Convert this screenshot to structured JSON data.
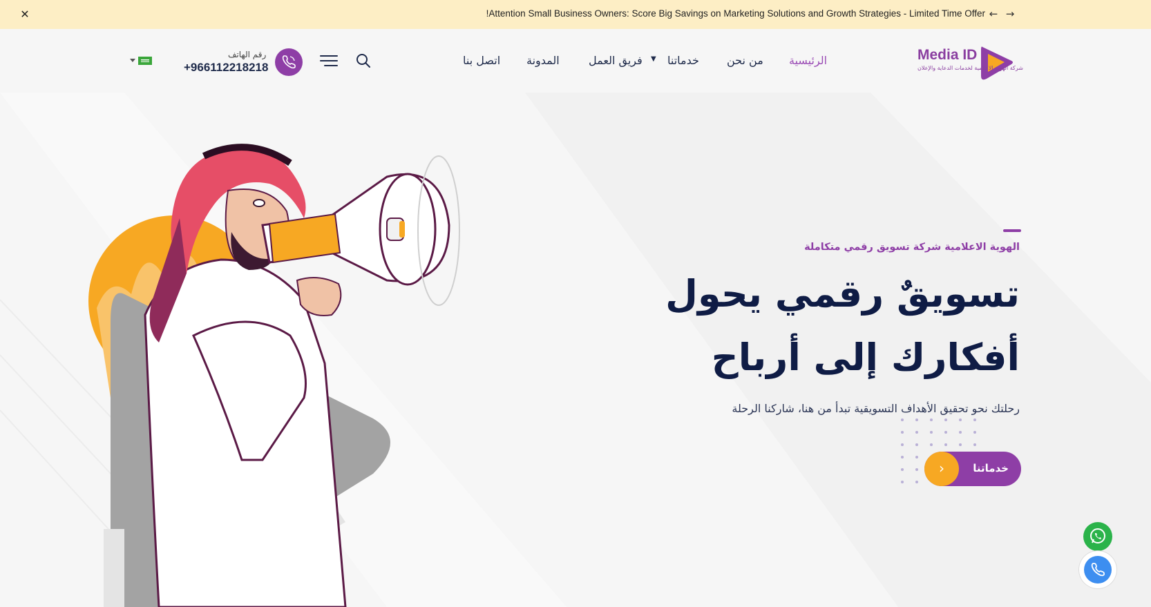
{
  "topbar": {
    "announcement": "!Attention Small Business Owners: Score Big Savings on Marketing Solutions and Growth Strategies - Limited Time Offer"
  },
  "header": {
    "logo_text": "Media ID",
    "logo_sub": "شركة الهوية الاعلامية لخدمات الدعاية والإعلان",
    "nav": [
      {
        "label": "الرئيسية",
        "active": true
      },
      {
        "label": "من نحن",
        "active": false
      },
      {
        "label": "خدماتنا",
        "active": false
      },
      {
        "label": "فريق العمل",
        "active": false
      },
      {
        "label": "المدونة",
        "active": false
      },
      {
        "label": "اتصل بنا",
        "active": false
      }
    ],
    "phone_label": "رقم الهاتف",
    "phone_number": "+966112218218"
  },
  "hero": {
    "kicker": "الهوية الاعلامية شركة تسويق رقمي متكاملة",
    "title_line1": "تسويقٌ رقمي يحول",
    "title_line2": "أفكارك إلى أرباح",
    "subtitle": "رحلتك نحو تحقيق الأهداف التسويقية تبدأ من هنا، شاركنا الرحلة",
    "cta_label": "خدماتنا"
  },
  "colors": {
    "brand_purple": "#8e3ea6",
    "accent_orange": "#f7a823",
    "topbar_bg": "#fdeec5",
    "heading_navy": "#0f1c45",
    "whatsapp_green": "#2bb34a",
    "call_blue": "#3d8ef0"
  },
  "icons": [
    "close-icon",
    "arrow-left-icon",
    "arrow-right-icon",
    "search-icon",
    "menu-icon",
    "phone-icon",
    "flag-icon",
    "whatsapp-icon",
    "chevron-down-icon",
    "chevron-right-icon"
  ]
}
